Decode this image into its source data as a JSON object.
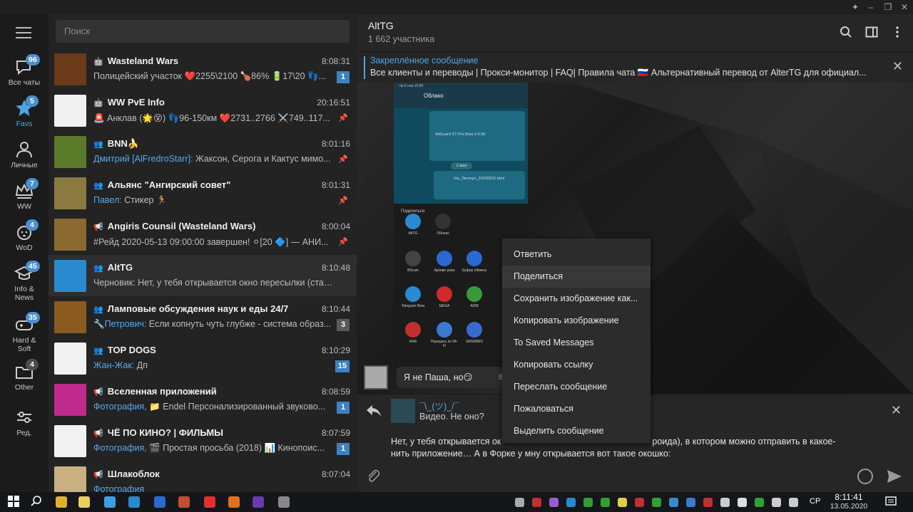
{
  "window": {
    "controls": [
      "pin-icon",
      "minimize-icon",
      "maximize-icon",
      "close-icon"
    ]
  },
  "folders": [
    {
      "label": "Все чаты",
      "badge": "96",
      "icon": "chats-icon"
    },
    {
      "label": "Favs",
      "badge": "5",
      "icon": "star-icon",
      "active": true
    },
    {
      "label": "Личные",
      "badge": "",
      "icon": "person-icon"
    },
    {
      "label": "WW",
      "badge": "7",
      "icon": "crown-icon"
    },
    {
      "label": "WoD",
      "badge": "4",
      "icon": "dog-icon"
    },
    {
      "label": "Info & News",
      "badge": "45",
      "icon": "graduation-cap-icon"
    },
    {
      "label": "Hard & Soft",
      "badge": "35",
      "icon": "gamepad-icon"
    },
    {
      "label": "Other",
      "badge": "4",
      "icon": "folder-icon"
    },
    {
      "label": "Ред.",
      "badge": "",
      "icon": "sliders-icon"
    }
  ],
  "search": {
    "placeholder": "Поиск"
  },
  "chats": [
    {
      "name": "Wasteland Wars",
      "type": "bot",
      "time": "8:08:31",
      "from": "",
      "msg": "Полицейский участок ❤️2255\\2100 🍗86% 🔋17\\20 👣...",
      "count": "1",
      "pinned": false,
      "avatar_color": "#6b3a1a"
    },
    {
      "name": "WW PvE Info",
      "type": "bot",
      "time": "20:16:51",
      "from": "",
      "msg": "🚨 Анклав (🌟😵) 👣96-150км ❤️2731..2766 ⚔️749..117...",
      "count": "",
      "pinned": true,
      "avatar_color": "#f0f0f0"
    },
    {
      "name": "BNN🍌",
      "type": "group",
      "time": "8:01:16",
      "from": "Дмитрий [AlFredroStarr]:",
      "msg": " Жаксон, Серога и Кактус мимо...",
      "count": "",
      "pinned": true,
      "avatar_color": "#5a7a2a"
    },
    {
      "name": "Альянс \"Ангирский совет\"",
      "type": "group",
      "time": "8:01:31",
      "from": "Павел:",
      "msg": " Стикер 🏃",
      "count": "",
      "pinned": true,
      "avatar_color": "#8a7a40"
    },
    {
      "name": "Angiris Counsil (Wasteland Wars)",
      "type": "channel",
      "time": "8:00:04",
      "from": "",
      "msg": "#Рейд 2020-05-13 09:00:00 завершен! ⚪[20 🔷] — АНИ...",
      "count": "",
      "pinned": true,
      "avatar_color": "#8a6a30"
    },
    {
      "name": "AltTG",
      "type": "group",
      "time": "8:10:48",
      "from": "",
      "msg": "Черновик: Нет, у тебя открывается окно пересылки (станда...",
      "count": "",
      "pinned": false,
      "avatar_color": "#2a8ad0",
      "active": true
    },
    {
      "name": "Ламповые обсуждения наук и еды 24/7",
      "type": "group",
      "time": "8:10:44",
      "from": "🔧Петрович:",
      "msg": " Если копнуть чуть глубже - система образ...",
      "count": "3",
      "count_grey": true,
      "pinned": false,
      "avatar_color": "#8a5a20"
    },
    {
      "name": "TOP DOGS",
      "type": "group",
      "time": "8:10:29",
      "from": "Жан-Жак:",
      "msg": " Дп",
      "count": "15",
      "pinned": false,
      "avatar_color": "#f2f2f2"
    },
    {
      "name": "Вселенная приложений",
      "type": "channel",
      "time": "8:08:59",
      "from": "Фотография,",
      "msg": " 📁 Endel  Персонализированный звуково...",
      "count": "1",
      "pinned": false,
      "avatar_color": "#c02a8a"
    },
    {
      "name": "ЧЁ ПО КИНО? | ФИЛЬМЫ",
      "type": "channel",
      "time": "8:07:59",
      "from": "Фотография,",
      "msg": " 🎬  Простая просьба (2018)  📊 Кинопоис...",
      "count": "1",
      "pinned": false,
      "avatar_color": "#f2f2f2"
    },
    {
      "name": "Шлакоблок",
      "type": "channel",
      "time": "8:07:04",
      "from": "Фотография",
      "msg": "",
      "count": "",
      "pinned": false,
      "avatar_color": "#c8b080"
    }
  ],
  "chat": {
    "title": "AltTG",
    "subtitle": "1 662 участника",
    "pinned_title": "Закреплённое сообщение",
    "pinned_text": "Все клиенты и переводы | Прокси-монитор | FAQ| Правила чата 🇷🇺 Альтернативный перевод от AlterTG для официал...",
    "incoming_text": "Я не Паша, но😏",
    "incoming_time": "8:",
    "phone": {
      "status": "пр 6 нов 15:09",
      "title": "Облако",
      "file1": "AdGuard ST Pro Beta 3.4.99",
      "date": "2 мая",
      "file2": "Via_Экспорт_20200502.html",
      "share_title": "Поделиться",
      "apps": [
        "AltTG",
        "Облако",
        "BGram",
        "Архиве рова",
        "Буфер обмена",
        "Telegram Beta",
        "MEGA",
        "ADM",
        "RAR",
        "Передать по Wi-Fi",
        "SMS/MMS"
      ]
    }
  },
  "compose": {
    "reply_name": "¯\\_(ツ)_/¯",
    "reply_text": "Видео. Не оно?",
    "draft_line1": "Нет, у тебя открывается ок",
    "draft_line1_end": "роида), в котором можно отправить в какое-",
    "draft_line2": "нить приложение… А в Форке у мну открывается вот такое окошко:"
  },
  "context_menu": [
    "Ответить",
    "Поделиться",
    "Сохранить изображение как...",
    "Копировать изображение",
    "To Saved Messages",
    "Копировать ссылку",
    "Переслать сообщение",
    "Пожаловаться",
    "Выделить сообщение"
  ],
  "taskbar": {
    "lang": "СР",
    "time": "8:11:41",
    "date": "13.05.2020"
  }
}
